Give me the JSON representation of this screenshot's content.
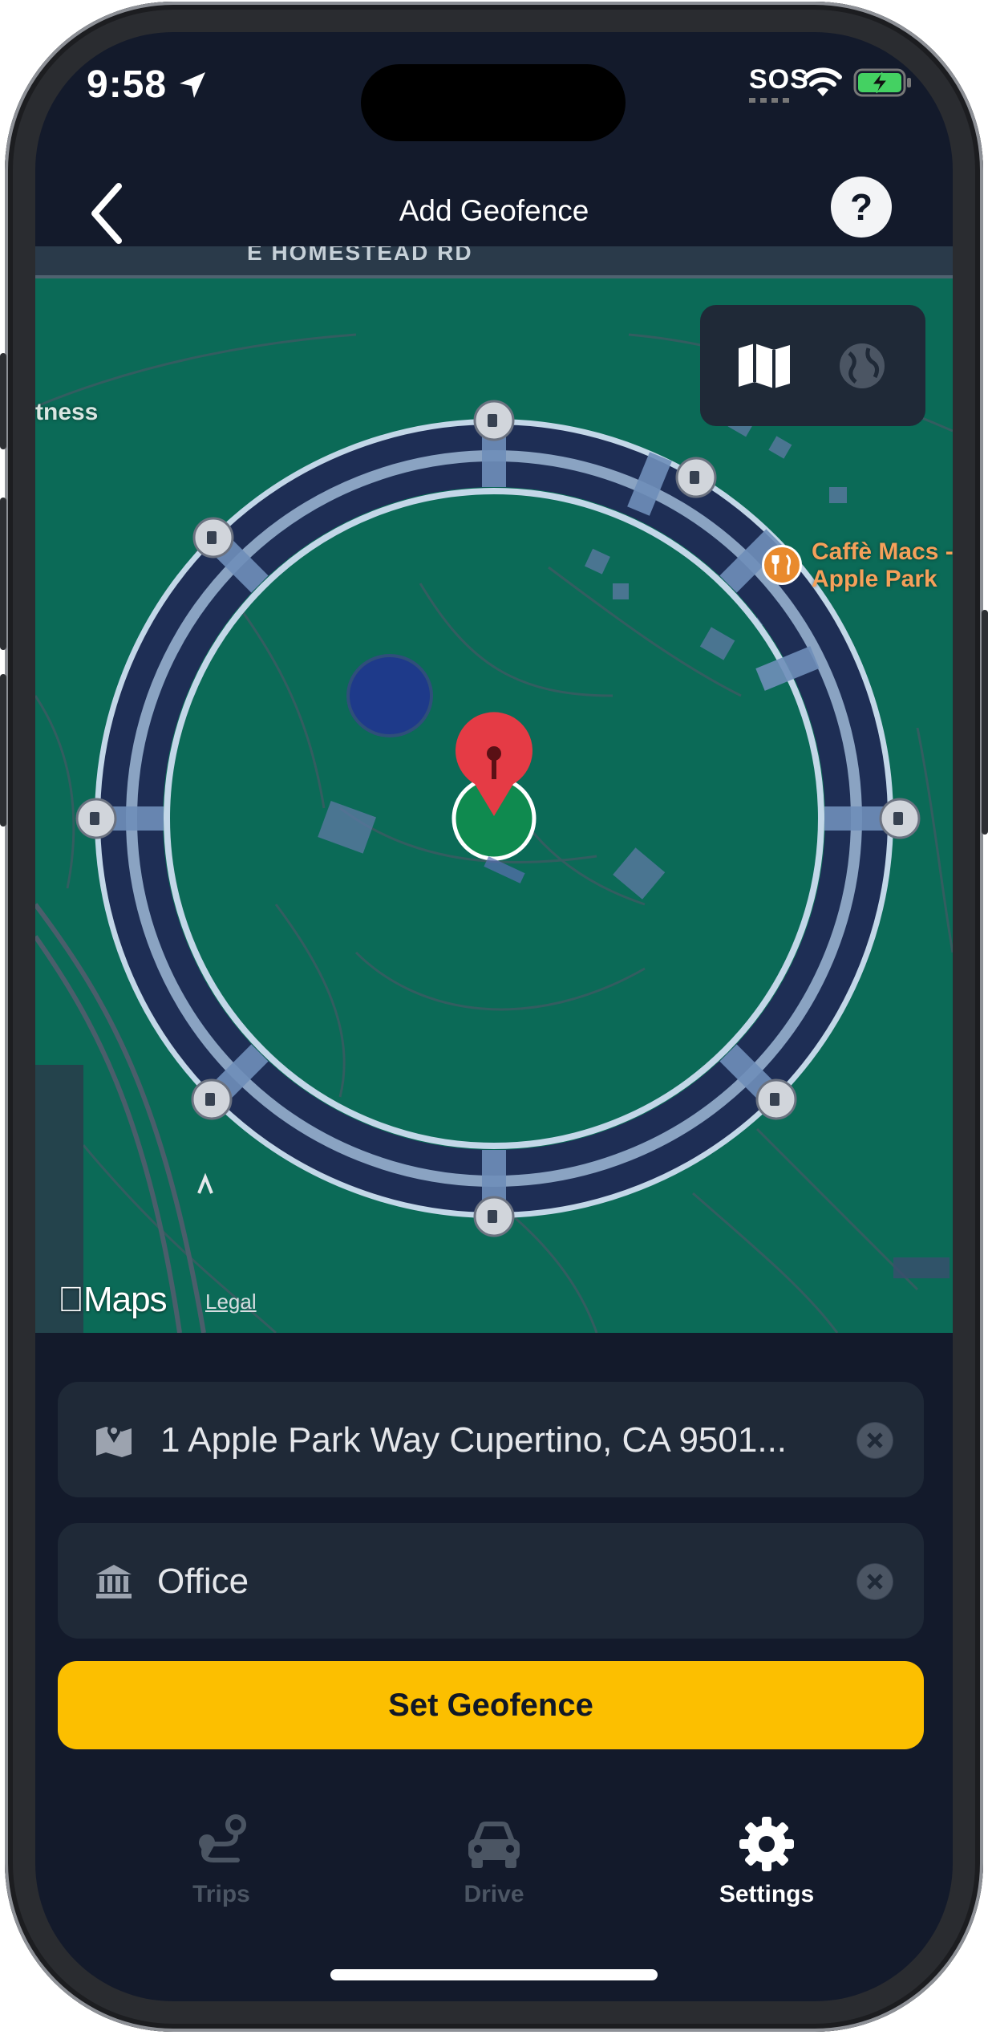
{
  "status_bar": {
    "time": "9:58",
    "sos": "SOS"
  },
  "header": {
    "title": "Add Geofence",
    "help_label": "?"
  },
  "map": {
    "road_label": "E HOMESTEAD RD",
    "side_label": "tness",
    "poi": {
      "name_line1": "Caffè Macs -",
      "name_line2": "Apple Park",
      "icon": "fork-knife-icon"
    },
    "attribution": "Maps",
    "legal": "Legal",
    "view_modes": [
      "map-icon",
      "globe-icon"
    ]
  },
  "form": {
    "address": {
      "value": "1 Apple Park Way Cupertino, CA 9501...",
      "icon": "map-pin-icon"
    },
    "label": {
      "value": "Office",
      "icon": "bank-icon"
    },
    "submit_label": "Set Geofence"
  },
  "tabs": [
    {
      "label": "Trips",
      "icon": "route-icon",
      "active": false
    },
    {
      "label": "Drive",
      "icon": "car-icon",
      "active": false
    },
    {
      "label": "Settings",
      "icon": "gear-icon",
      "active": true
    }
  ],
  "colors": {
    "background": "#131a2b",
    "map_green": "#0b6a57",
    "accent": "#fcbf00",
    "pin_red": "#e53b45",
    "tab_inactive": "#4b5563",
    "tab_active": "#ffffff"
  }
}
